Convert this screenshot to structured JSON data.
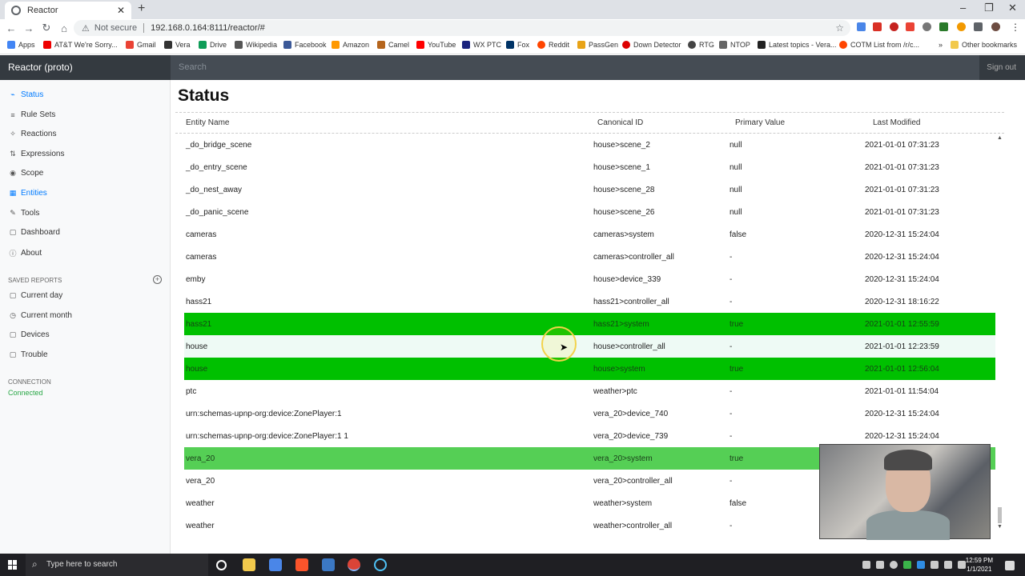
{
  "browser": {
    "tab_title": "Reactor",
    "url": "192.168.0.164:8111/reactor/#",
    "security_label": "Not secure",
    "bookmarks": [
      "Apps",
      "AT&T We're Sorry...",
      "Gmail",
      "Vera",
      "Drive",
      "Wikipedia",
      "Facebook",
      "Amazon",
      "Camel",
      "YouTube",
      "WX PTC",
      "Fox",
      "Reddit",
      "PassGen",
      "Down Detector",
      "RTG",
      "NTOP",
      "Latest topics - Vera...",
      "COTM List from /r/c...",
      "Other bookmarks"
    ]
  },
  "header": {
    "brand": "Reactor (proto)",
    "search_placeholder": "Search",
    "signout": "Sign out"
  },
  "sidebar": {
    "nav": [
      {
        "label": "Status",
        "icon": "pulse-icon",
        "glyph": "⌁"
      },
      {
        "label": "Rule Sets",
        "icon": "list-icon",
        "glyph": "≡"
      },
      {
        "label": "Reactions",
        "icon": "sparkle-icon",
        "glyph": "✧"
      },
      {
        "label": "Expressions",
        "icon": "sliders-icon",
        "glyph": "⇅"
      },
      {
        "label": "Scope",
        "icon": "eye-icon",
        "glyph": "◉"
      },
      {
        "label": "Entities",
        "icon": "grid-icon",
        "glyph": "▦"
      },
      {
        "label": "Tools",
        "icon": "wrench-icon",
        "glyph": "✎"
      },
      {
        "label": "Dashboard",
        "icon": "dashboard-icon",
        "glyph": "▢"
      },
      {
        "label": "About",
        "icon": "info-icon",
        "glyph": "ⓘ"
      }
    ],
    "saved_reports_header": "SAVED REPORTS",
    "reports": [
      {
        "label": "Current day",
        "glyph": "▢"
      },
      {
        "label": "Current month",
        "glyph": "◷"
      },
      {
        "label": "Devices",
        "glyph": "▢"
      },
      {
        "label": "Trouble",
        "glyph": "▢"
      }
    ],
    "connection_header": "CONNECTION",
    "connection_status": "Connected"
  },
  "main": {
    "title": "Status",
    "columns": [
      "Entity Name",
      "Canonical ID",
      "Primary Value",
      "Last Modified"
    ],
    "rows": [
      {
        "name": "_do_bridge_scene",
        "id": "house>scene_2",
        "value": "null",
        "modified": "2021-01-01 07:31:23",
        "style": ""
      },
      {
        "name": "_do_entry_scene",
        "id": "house>scene_1",
        "value": "null",
        "modified": "2021-01-01 07:31:23",
        "style": ""
      },
      {
        "name": "_do_nest_away",
        "id": "house>scene_28",
        "value": "null",
        "modified": "2021-01-01 07:31:23",
        "style": ""
      },
      {
        "name": "_do_panic_scene",
        "id": "house>scene_26",
        "value": "null",
        "modified": "2021-01-01 07:31:23",
        "style": ""
      },
      {
        "name": "cameras",
        "id": "cameras>system",
        "value": "false",
        "modified": "2020-12-31 15:24:04",
        "style": ""
      },
      {
        "name": "cameras",
        "id": "cameras>controller_all",
        "value": "-",
        "modified": "2020-12-31 15:24:04",
        "style": ""
      },
      {
        "name": "emby",
        "id": "house>device_339",
        "value": "-",
        "modified": "2020-12-31 15:24:04",
        "style": ""
      },
      {
        "name": "hass21",
        "id": "hass21>controller_all",
        "value": "-",
        "modified": "2020-12-31 18:16:22",
        "style": ""
      },
      {
        "name": "hass21",
        "id": "hass21>system",
        "value": "true",
        "modified": "2021-01-01 12:55:59",
        "style": "green"
      },
      {
        "name": "house",
        "id": "house>controller_all",
        "value": "-",
        "modified": "2021-01-01 12:23:59",
        "style": "hover"
      },
      {
        "name": "house",
        "id": "house>system",
        "value": "true",
        "modified": "2021-01-01 12:56:04",
        "style": "green"
      },
      {
        "name": "ptc",
        "id": "weather>ptc",
        "value": "-",
        "modified": "2021-01-01 11:54:04",
        "style": ""
      },
      {
        "name": "urn:schemas-upnp-org:device:ZonePlayer:1",
        "id": "vera_20>device_740",
        "value": "-",
        "modified": "2020-12-31 15:24:04",
        "style": ""
      },
      {
        "name": "urn:schemas-upnp-org:device:ZonePlayer:1 1",
        "id": "vera_20>device_739",
        "value": "-",
        "modified": "2020-12-31 15:24:04",
        "style": ""
      },
      {
        "name": "vera_20",
        "id": "vera_20>system",
        "value": "true",
        "modified": "",
        "style": "lightgreen"
      },
      {
        "name": "vera_20",
        "id": "vera_20>controller_all",
        "value": "-",
        "modified": "",
        "style": ""
      },
      {
        "name": "weather",
        "id": "weather>system",
        "value": "false",
        "modified": "",
        "style": ""
      },
      {
        "name": "weather",
        "id": "weather>controller_all",
        "value": "-",
        "modified": "",
        "style": ""
      }
    ]
  },
  "taskbar": {
    "search_placeholder": "Type here to search",
    "time": "12:59 PM",
    "date": "1/1/2021"
  },
  "colors": {
    "active_row": "#00c000",
    "stale_row": "#55cf55",
    "accent": "#007bff",
    "connected": "#28a745"
  }
}
